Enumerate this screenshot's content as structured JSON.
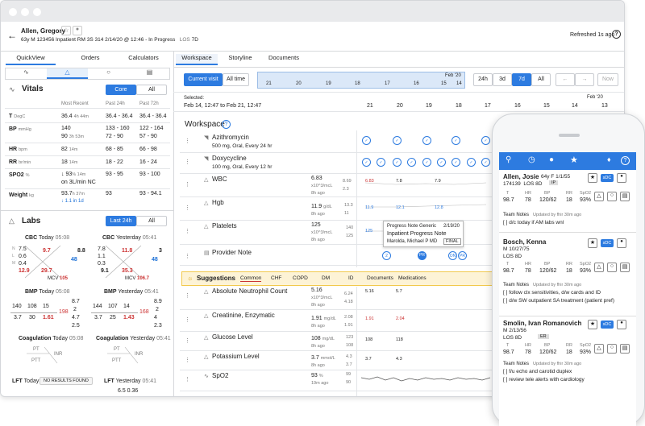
{
  "patient": {
    "name": "Allen, Gregory",
    "age": "63y",
    "sex": "M",
    "mrn": "123456",
    "status": "Inpatient",
    "room": "RM 3S 314",
    "admit": "2/14/20 @ 12:46 - In Progress",
    "los_label": "LOS",
    "los": "7D",
    "refreshed": "Refreshed 1s ago"
  },
  "left_tabs": [
    "QuickView",
    "Orders",
    "Calculators"
  ],
  "vitals": {
    "title": "Vitals",
    "toggle": [
      "Core",
      "All"
    ],
    "cols": [
      "Most Recent",
      "Past 24h",
      "Past 72h"
    ],
    "rows": [
      {
        "name": "T",
        "unit": "DegC",
        "recent": "36.4",
        "recent_ago": "4h 44m",
        "p24": "36.4 - 36.4",
        "p72": "36.4 - 36.4"
      },
      {
        "name": "BP",
        "unit": "mmHg",
        "recent": "140",
        "recent2": "90",
        "recent_ago": "3h 53m",
        "p24": "133 - 160",
        "p24b": "72 - 90",
        "p72": "122 - 164",
        "p72b": "57 - 90"
      },
      {
        "name": "HR",
        "unit": "bpm",
        "recent": "82",
        "recent_ago": "14m",
        "p24": "68 - 85",
        "p72": "66 - 98"
      },
      {
        "name": "RR",
        "unit": "br/min",
        "recent": "18",
        "recent_ago": "14m",
        "p24": "18 - 22",
        "p72": "16 - 24"
      },
      {
        "name": "SPO2",
        "unit": "%",
        "recent": "↓ 93",
        "recent_ago": "% 14m",
        "recent2": "on 3L/min NC",
        "p24": "93 - 95",
        "p72": "93 - 100"
      },
      {
        "name": "Weight",
        "unit": "kg",
        "recent": "93.7",
        "recent_ago": "h 37m",
        "recent2": "↓ 1.1 in 1d",
        "p24": "93",
        "p72": "93 - 94.1"
      }
    ]
  },
  "labs": {
    "title": "Labs",
    "toggle": [
      "Last 24h",
      "All"
    ],
    "cbc_today": {
      "title": "CBC",
      "when": "Today",
      "time": "05:08",
      "hgb": "9.7",
      "wbc": "12.9",
      "hct": "29.7",
      "plt": "48",
      "extra": "8.8",
      "mcv": "105",
      "n": "7.5",
      "l": "0.6",
      "m": "0.4"
    },
    "cbc_yest": {
      "title": "CBC",
      "when": "Yesterday",
      "time": "05:41",
      "hgb": "11.8",
      "wbc": "9.1",
      "hct": "35.3",
      "plt": "48",
      "extra": "3",
      "mcv": "106.7",
      "n": "7.8",
      "l": "1.1",
      "m": "0.3"
    },
    "bmp_today": {
      "title": "BMP",
      "when": "Today",
      "time": "05:08",
      "na": "140",
      "cl": "108",
      "bun": "15",
      "k": "3.7",
      "co2": "30",
      "cr": "1.61",
      "glu": "198",
      "ca": "8.7",
      "mg": "2",
      "po4": "4.7",
      "alb": "2.5"
    },
    "bmp_yest": {
      "title": "BMP",
      "when": "Yesterday",
      "time": "05:41",
      "na": "144",
      "cl": "107",
      "bun": "14",
      "k": "3.7",
      "co2": "25",
      "cr": "1.43",
      "glu": "168",
      "ca": "8.9",
      "mg": "2",
      "po4": "4",
      "alb": "2.3"
    },
    "coag_today": {
      "title": "Coagulation",
      "when": "Today",
      "time": "05:08",
      "pt": "PT",
      "inr": "INR",
      "ptt": "PTT"
    },
    "coag_yest": {
      "title": "Coagulation",
      "when": "Yesterday",
      "time": "05:41"
    },
    "lft_today": {
      "title": "LFT",
      "when": "Today",
      "badge": "NO RESULTS FOUND"
    },
    "lft_yest": {
      "title": "LFT",
      "when": "Yesterday",
      "time": "05:41",
      "vals": "6.5  0.36"
    }
  },
  "main_tabs": [
    "Workspace",
    "Storyline",
    "Documents"
  ],
  "timeline": {
    "current": "Current visit",
    "all": "All time",
    "month": "Feb '20",
    "ticks": [
      "21",
      "20",
      "19",
      "18",
      "17",
      "16",
      "15",
      "14"
    ],
    "ranges": [
      "24h",
      "3d",
      "7d",
      "All"
    ],
    "now": "Now",
    "selected_label": "Selected:",
    "selected": "Feb 14, 12:47 to Feb 21, 12:47",
    "cols": [
      "21",
      "20",
      "19",
      "18",
      "17",
      "16",
      "15",
      "14",
      "13"
    ]
  },
  "workspace": {
    "title": "Workspace",
    "meds": [
      {
        "name": "Azithromycin",
        "detail": "500 mg, Oral, Every 24 hr"
      },
      {
        "name": "Doxycycline",
        "detail": "100 mg, Oral, Every 12 hr"
      }
    ],
    "labs": [
      {
        "name": "WBC",
        "value": "6.83",
        "unit": "x10^3/mcL",
        "ago": "8h ago",
        "hi": "8.69",
        "lo": "2.3",
        "pts": [
          "6.83",
          "7.8",
          "7.9"
        ]
      },
      {
        "name": "Hgb",
        "value": "11.9",
        "unit": "g/dL",
        "ago": "8h ago",
        "hi": "13.3",
        "lo": "11",
        "pts": [
          "11.9",
          "12.1",
          "12.8"
        ]
      },
      {
        "name": "Platelets",
        "value": "125",
        "unit": "x10^3/mcL",
        "ago": "8h ago",
        "hi": "140",
        "lo": "125",
        "pts": [
          "125"
        ]
      }
    ],
    "note": {
      "name": "Provider Note",
      "popup_title": "Progress Note Generic",
      "popup_date": "2/19/20",
      "popup_type": "Inpatient Progress Note",
      "popup_author": "Marolda, Michael P MD",
      "popup_status": "FINAL"
    }
  },
  "suggestions": {
    "title": "Suggestions",
    "tabs": [
      "Common",
      "CHF",
      "COPD",
      "DM",
      "ID",
      "Documents",
      "Medications"
    ],
    "rows": [
      {
        "name": "Absolute Neutrophil Count",
        "value": "5.16",
        "unit": "x10^3/mcL",
        "ago": "8h ago",
        "hi": "6.24",
        "lo": "4.18",
        "pts": [
          "5.16",
          "5.7"
        ]
      },
      {
        "name": "Creatinine, Enzymatic",
        "value": "1.91",
        "unit": "mg/dL",
        "ago": "8h ago",
        "hi": "2.08",
        "lo": "1.91",
        "pts": [
          "1.91",
          "2.04"
        ]
      },
      {
        "name": "Glucose Level",
        "value": "108",
        "unit": "mg/dL",
        "ago": "8h ago",
        "hi": "123",
        "lo": "108",
        "pts": [
          "108",
          "118"
        ]
      },
      {
        "name": "Potassium Level",
        "value": "3.7",
        "unit": "mmol/L",
        "ago": "8h ago",
        "hi": "4.3",
        "lo": "3.7",
        "pts": [
          "3.7",
          "4.3"
        ]
      },
      {
        "name": "SpO2",
        "value": "93",
        "unit": "%",
        "ago": "19m ago",
        "hi": "99",
        "lo": "90",
        "pts": []
      }
    ]
  },
  "phone": {
    "patients": [
      {
        "name": "Allen, Josie",
        "age": "64y",
        "sex": "F",
        "dob": "1/1/55",
        "mrn": "174139",
        "los": "LOS 8D",
        "tag": "IP",
        "vals": {
          "T": "98.7",
          "HR": "78",
          "BP": "120/62",
          "RR": "18",
          "SpO2": "93%"
        },
        "note_label": "Team Notes",
        "note_meta": "Updated by fhir 30m ago",
        "notes": [
          "[ ] d/c today if AM labs wnl"
        ]
      },
      {
        "name": "Bosch, Kenna",
        "age": "",
        "sex": "M",
        "dob": "10/27/75",
        "mrn": "",
        "los": "LOS 8D",
        "tag": "",
        "vals": {
          "T": "98.7",
          "HR": "78",
          "BP": "120/62",
          "RR": "18",
          "SpO2": "93%"
        },
        "note_label": "Team Notes",
        "note_meta": "Updated by fhir 30m ago",
        "notes": [
          "[ ] follow clx sensitivities, d/w cards and ID",
          "[ ] d/w SW outpatient SA treatment (patient pref)"
        ]
      },
      {
        "name": "Smolin, Ivan Romanovich",
        "age": "",
        "sex": "M",
        "dob": "2/13/56",
        "mrn": "",
        "los": "LOS 8D",
        "tag": "ER",
        "vals": {
          "T": "98.7",
          "HR": "78",
          "BP": "120/62",
          "RR": "18",
          "SpO2": "93%"
        },
        "note_label": "Team Notes",
        "note_meta": "Updated by fhir 30m ago",
        "notes": [
          "[ ] f/u echo and carotid duplex",
          "[ ] review tele alerts with cardiology"
        ]
      }
    ],
    "sdc": "sDC"
  }
}
